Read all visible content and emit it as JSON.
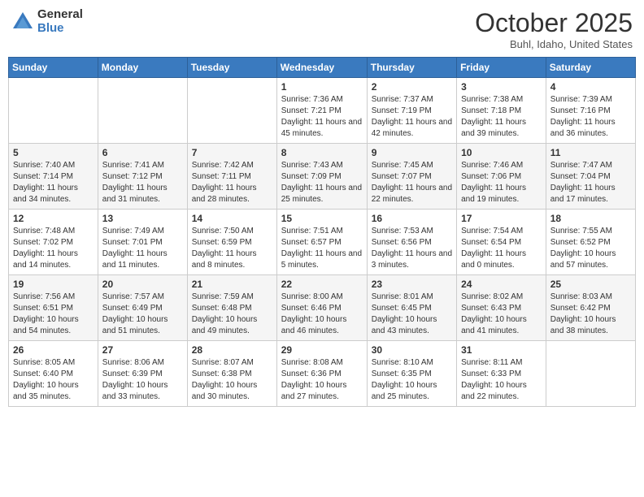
{
  "header": {
    "logo_general": "General",
    "logo_blue": "Blue",
    "month_title": "October 2025",
    "location": "Buhl, Idaho, United States"
  },
  "days_of_week": [
    "Sunday",
    "Monday",
    "Tuesday",
    "Wednesday",
    "Thursday",
    "Friday",
    "Saturday"
  ],
  "weeks": [
    [
      {
        "num": "",
        "sunrise": "",
        "sunset": "",
        "daylight": ""
      },
      {
        "num": "",
        "sunrise": "",
        "sunset": "",
        "daylight": ""
      },
      {
        "num": "",
        "sunrise": "",
        "sunset": "",
        "daylight": ""
      },
      {
        "num": "1",
        "sunrise": "Sunrise: 7:36 AM",
        "sunset": "Sunset: 7:21 PM",
        "daylight": "Daylight: 11 hours and 45 minutes."
      },
      {
        "num": "2",
        "sunrise": "Sunrise: 7:37 AM",
        "sunset": "Sunset: 7:19 PM",
        "daylight": "Daylight: 11 hours and 42 minutes."
      },
      {
        "num": "3",
        "sunrise": "Sunrise: 7:38 AM",
        "sunset": "Sunset: 7:18 PM",
        "daylight": "Daylight: 11 hours and 39 minutes."
      },
      {
        "num": "4",
        "sunrise": "Sunrise: 7:39 AM",
        "sunset": "Sunset: 7:16 PM",
        "daylight": "Daylight: 11 hours and 36 minutes."
      }
    ],
    [
      {
        "num": "5",
        "sunrise": "Sunrise: 7:40 AM",
        "sunset": "Sunset: 7:14 PM",
        "daylight": "Daylight: 11 hours and 34 minutes."
      },
      {
        "num": "6",
        "sunrise": "Sunrise: 7:41 AM",
        "sunset": "Sunset: 7:12 PM",
        "daylight": "Daylight: 11 hours and 31 minutes."
      },
      {
        "num": "7",
        "sunrise": "Sunrise: 7:42 AM",
        "sunset": "Sunset: 7:11 PM",
        "daylight": "Daylight: 11 hours and 28 minutes."
      },
      {
        "num": "8",
        "sunrise": "Sunrise: 7:43 AM",
        "sunset": "Sunset: 7:09 PM",
        "daylight": "Daylight: 11 hours and 25 minutes."
      },
      {
        "num": "9",
        "sunrise": "Sunrise: 7:45 AM",
        "sunset": "Sunset: 7:07 PM",
        "daylight": "Daylight: 11 hours and 22 minutes."
      },
      {
        "num": "10",
        "sunrise": "Sunrise: 7:46 AM",
        "sunset": "Sunset: 7:06 PM",
        "daylight": "Daylight: 11 hours and 19 minutes."
      },
      {
        "num": "11",
        "sunrise": "Sunrise: 7:47 AM",
        "sunset": "Sunset: 7:04 PM",
        "daylight": "Daylight: 11 hours and 17 minutes."
      }
    ],
    [
      {
        "num": "12",
        "sunrise": "Sunrise: 7:48 AM",
        "sunset": "Sunset: 7:02 PM",
        "daylight": "Daylight: 11 hours and 14 minutes."
      },
      {
        "num": "13",
        "sunrise": "Sunrise: 7:49 AM",
        "sunset": "Sunset: 7:01 PM",
        "daylight": "Daylight: 11 hours and 11 minutes."
      },
      {
        "num": "14",
        "sunrise": "Sunrise: 7:50 AM",
        "sunset": "Sunset: 6:59 PM",
        "daylight": "Daylight: 11 hours and 8 minutes."
      },
      {
        "num": "15",
        "sunrise": "Sunrise: 7:51 AM",
        "sunset": "Sunset: 6:57 PM",
        "daylight": "Daylight: 11 hours and 5 minutes."
      },
      {
        "num": "16",
        "sunrise": "Sunrise: 7:53 AM",
        "sunset": "Sunset: 6:56 PM",
        "daylight": "Daylight: 11 hours and 3 minutes."
      },
      {
        "num": "17",
        "sunrise": "Sunrise: 7:54 AM",
        "sunset": "Sunset: 6:54 PM",
        "daylight": "Daylight: 11 hours and 0 minutes."
      },
      {
        "num": "18",
        "sunrise": "Sunrise: 7:55 AM",
        "sunset": "Sunset: 6:52 PM",
        "daylight": "Daylight: 10 hours and 57 minutes."
      }
    ],
    [
      {
        "num": "19",
        "sunrise": "Sunrise: 7:56 AM",
        "sunset": "Sunset: 6:51 PM",
        "daylight": "Daylight: 10 hours and 54 minutes."
      },
      {
        "num": "20",
        "sunrise": "Sunrise: 7:57 AM",
        "sunset": "Sunset: 6:49 PM",
        "daylight": "Daylight: 10 hours and 51 minutes."
      },
      {
        "num": "21",
        "sunrise": "Sunrise: 7:59 AM",
        "sunset": "Sunset: 6:48 PM",
        "daylight": "Daylight: 10 hours and 49 minutes."
      },
      {
        "num": "22",
        "sunrise": "Sunrise: 8:00 AM",
        "sunset": "Sunset: 6:46 PM",
        "daylight": "Daylight: 10 hours and 46 minutes."
      },
      {
        "num": "23",
        "sunrise": "Sunrise: 8:01 AM",
        "sunset": "Sunset: 6:45 PM",
        "daylight": "Daylight: 10 hours and 43 minutes."
      },
      {
        "num": "24",
        "sunrise": "Sunrise: 8:02 AM",
        "sunset": "Sunset: 6:43 PM",
        "daylight": "Daylight: 10 hours and 41 minutes."
      },
      {
        "num": "25",
        "sunrise": "Sunrise: 8:03 AM",
        "sunset": "Sunset: 6:42 PM",
        "daylight": "Daylight: 10 hours and 38 minutes."
      }
    ],
    [
      {
        "num": "26",
        "sunrise": "Sunrise: 8:05 AM",
        "sunset": "Sunset: 6:40 PM",
        "daylight": "Daylight: 10 hours and 35 minutes."
      },
      {
        "num": "27",
        "sunrise": "Sunrise: 8:06 AM",
        "sunset": "Sunset: 6:39 PM",
        "daylight": "Daylight: 10 hours and 33 minutes."
      },
      {
        "num": "28",
        "sunrise": "Sunrise: 8:07 AM",
        "sunset": "Sunset: 6:38 PM",
        "daylight": "Daylight: 10 hours and 30 minutes."
      },
      {
        "num": "29",
        "sunrise": "Sunrise: 8:08 AM",
        "sunset": "Sunset: 6:36 PM",
        "daylight": "Daylight: 10 hours and 27 minutes."
      },
      {
        "num": "30",
        "sunrise": "Sunrise: 8:10 AM",
        "sunset": "Sunset: 6:35 PM",
        "daylight": "Daylight: 10 hours and 25 minutes."
      },
      {
        "num": "31",
        "sunrise": "Sunrise: 8:11 AM",
        "sunset": "Sunset: 6:33 PM",
        "daylight": "Daylight: 10 hours and 22 minutes."
      },
      {
        "num": "",
        "sunrise": "",
        "sunset": "",
        "daylight": ""
      }
    ]
  ]
}
